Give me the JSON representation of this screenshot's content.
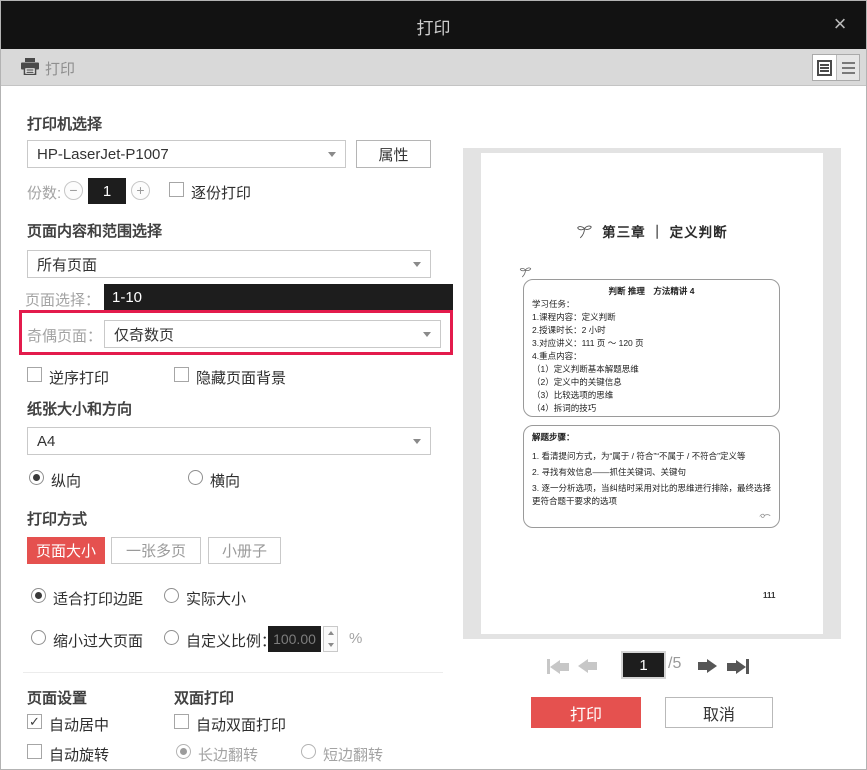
{
  "window": {
    "title": "打印",
    "close_glyph": "×"
  },
  "toolbar": {
    "label": "打印"
  },
  "printer_section": {
    "title": "打印机选择",
    "printer_name": "HP-LaserJet-P1007",
    "properties": "属性",
    "copies_label": "份数:",
    "copies_value": "1",
    "minus": "−",
    "plus": "+",
    "collate": "逐份打印"
  },
  "range_section": {
    "title": "页面内容和范围选择",
    "all_pages": "所有页面",
    "page_select_label": "页面选择：",
    "page_select_value": "1-10",
    "odd_even_label": "奇偶页面：",
    "odd_even_value": "仅奇数页",
    "reverse": "逆序打印",
    "hide_background": "隐藏页面背景"
  },
  "paper_section": {
    "title": "纸张大小和方向",
    "size": "A4",
    "portrait": "纵向",
    "landscape": "横向"
  },
  "mode_section": {
    "title": "打印方式",
    "tabs": [
      "页面大小",
      "一张多页",
      "小册子"
    ],
    "fit_margins": "适合打印边距",
    "actual_size": "实际大小",
    "shrink_oversized": "缩小过大页面",
    "custom_scale_label": "自定义比例：",
    "scale_value": "100.00",
    "percent": "%"
  },
  "page_setup_section": {
    "title": "页面设置",
    "auto_center": "自动居中",
    "auto_rotate": "自动旋转",
    "check": "✓"
  },
  "duplex_section": {
    "title": "双面打印",
    "auto_duplex": "自动双面打印",
    "long_edge": "长边翻转",
    "short_edge": "短边翻转"
  },
  "preview": {
    "chapter_title": "第三章 ｜ 定义判断",
    "box1_title": "判断 推理　方法精讲 4",
    "box1_lines": [
      "学习任务：",
      "1.课程内容：定义判断",
      "2.授课时长：2 小时",
      "3.对应讲义：111 页 ～ 120 页",
      "4.重点内容：",
      "（1）定义判断基本解题思维",
      "（2）定义中的关键信息",
      "（3）比较选项的思维",
      "（4）拆词的技巧"
    ],
    "box2_title": "解题步骤：",
    "box2_lines": [
      "1. 看清提问方式，为“属于 / 符合”“不属于 / 不符合”定义等",
      "2. 寻找有效信息——抓住关键词、关键句",
      "3. 逐一分析选项，当纠结时采用对比的思维进行排除，最终选择更符合题干要求的选项"
    ],
    "page_number": "111"
  },
  "nav": {
    "current_page": "1",
    "page_total": "/5"
  },
  "actions": {
    "print": "打印",
    "cancel": "取消"
  },
  "colors": {
    "accent_red": "#e5514f",
    "annotation_red": "#e31b4c",
    "dark_field": "#1d1d1d",
    "titlebar_bg": "#121212",
    "toolbar_bg": "#d9d9d9",
    "preview_bg": "#e3e3e3"
  }
}
